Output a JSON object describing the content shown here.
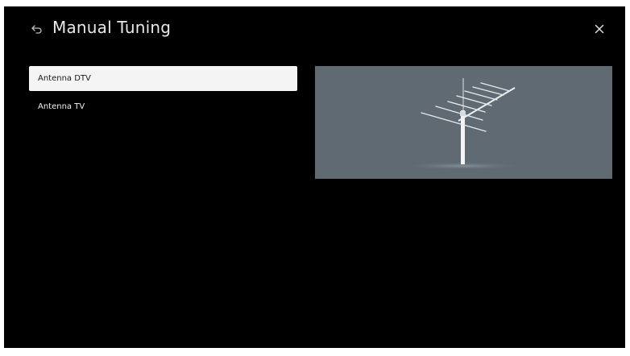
{
  "header": {
    "title": "Manual Tuning",
    "back_icon": "back-arrow-icon",
    "close_icon": "close-icon"
  },
  "menu": {
    "items": [
      {
        "label": "Antenna DTV",
        "selected": true
      },
      {
        "label": "Antenna TV",
        "selected": false
      }
    ]
  },
  "preview": {
    "illustration": "antenna-icon"
  },
  "colors": {
    "background": "#000000",
    "selected_item_bg": "#f4f4f4",
    "preview_bg": "#5f6a73"
  }
}
